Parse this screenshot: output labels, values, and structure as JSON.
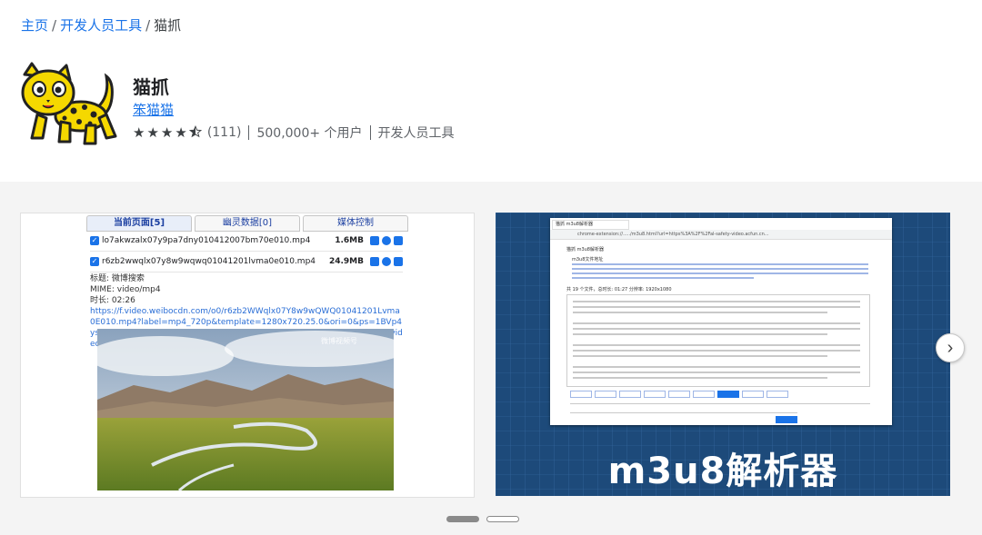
{
  "breadcrumb": {
    "home": "主页",
    "category": "开发人员工具",
    "current": "猫抓",
    "separator": "/"
  },
  "extension": {
    "icon": "cat-logo",
    "title": "猫抓",
    "author": "笨猫猫",
    "rating": 4.5,
    "rating_count": "(111)",
    "users": "500,000+ 个用户",
    "category": "开发人员工具"
  },
  "screenshot1": {
    "tabs": [
      {
        "label": "当前页面[5]",
        "active": true
      },
      {
        "label": "幽灵数据[0]",
        "active": false
      },
      {
        "label": "媒体控制",
        "active": false
      }
    ],
    "files": [
      {
        "name": "lo7akwzalx07y9pa7dny010412007bm70e010.mp4",
        "size": "1.6MB"
      },
      {
        "name": "r6zb2wwqlx07y8w9wqwq01041201lvma0e010.mp4",
        "size": "24.9MB"
      }
    ],
    "info": {
      "title_line": "标题: 微博搜索",
      "mime_line": "MIME: video/mp4",
      "duration_line": "时长: 02:26",
      "url": "https://f.video.weibocdn.com/o0/r6zb2WWqlx07Y8w9wQWQ01041201Lvma0E010.mp4?label=mp4_720p&template=1280x720.25.0&ori=0&ps=1BVp4ysnknHVZu&Expires=1659600129&ssig=Mg059g%2FvTC&KID=unistore,video"
    },
    "photo_watermark": "微博视频号"
  },
  "screenshot2": {
    "tab_title": "猫抓 m3u8解析器",
    "address": "chrome-extension://...../m3u8.html?url=https%3A%2F%2Fal-safety-video.acfun.cn...",
    "page_title": "猫抓 m3u8解析器",
    "m3u8_label": "m3u8文件地址",
    "stats": "共 19 个文件，总时长: 01:27  分辨率: 1920x1080",
    "banner": "m3u8解析器"
  },
  "carousel": {
    "slides": 2,
    "active_index": 0,
    "next_icon": "chevron-right-icon"
  },
  "colors": {
    "link": "#1a73e8",
    "banner_bg": "#1d4a7a"
  }
}
